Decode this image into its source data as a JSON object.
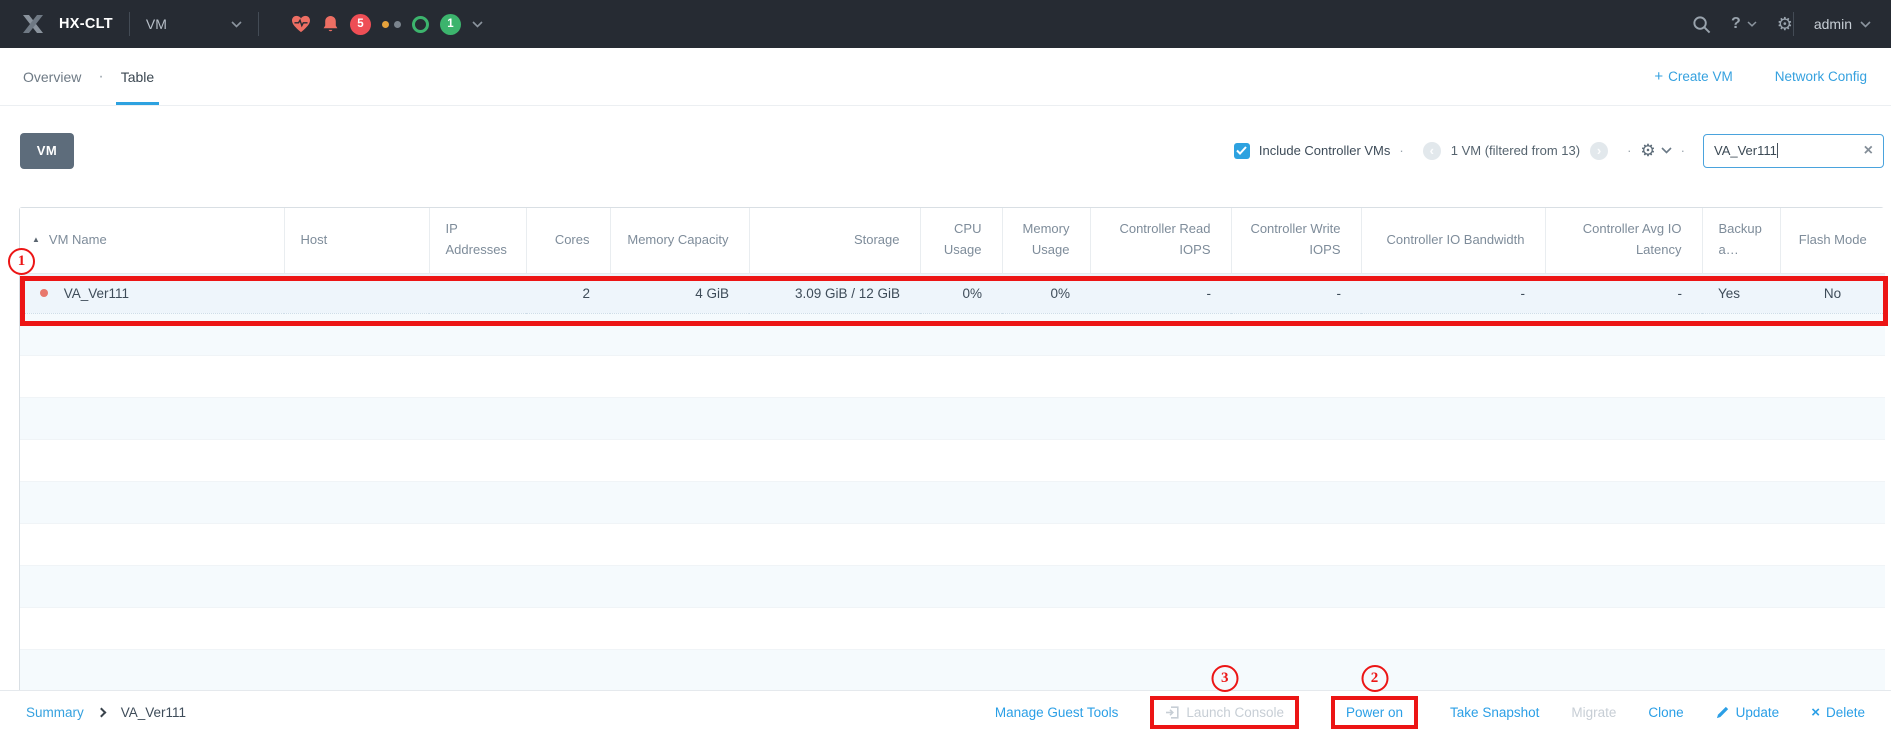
{
  "topnav": {
    "cluster_name": "HX-CLT",
    "entity_menu_label": "VM",
    "alert_count": "5",
    "healthy_count": "1",
    "help_label": "?",
    "username": "admin"
  },
  "subnav": {
    "tabs": [
      {
        "label": "Overview",
        "active": false
      },
      {
        "label": "Table",
        "active": true
      }
    ],
    "actions": [
      {
        "label": "Create VM"
      },
      {
        "label": "Network Config"
      }
    ]
  },
  "toolbar": {
    "entity_button_label": "VM",
    "include_controller_label": "Include Controller VMs",
    "filter_summary": "1 VM (filtered from 13)",
    "search_value": "VA_Ver111"
  },
  "table": {
    "columns": [
      {
        "label": "VM Name",
        "sorted": "asc"
      },
      {
        "label": "Host"
      },
      {
        "label": "IP Addresses"
      },
      {
        "label": "Cores"
      },
      {
        "label": "Memory Capacity"
      },
      {
        "label": "Storage"
      },
      {
        "label": "CPU Usage"
      },
      {
        "label": "Memory Usage"
      },
      {
        "label": "Controller Read IOPS"
      },
      {
        "label": "Controller Write IOPS"
      },
      {
        "label": "Controller IO Bandwidth"
      },
      {
        "label": "Controller Avg IO Latency"
      },
      {
        "label": "Backup a…"
      },
      {
        "label": "Flash Mode"
      }
    ],
    "row": {
      "power_state": "off",
      "cells": [
        "VA_Ver111",
        "",
        "",
        "2",
        "4 GiB",
        "3.09 GiB / 12 GiB",
        "0%",
        "0%",
        "-",
        "-",
        "-",
        "-",
        "Yes",
        "No"
      ]
    }
  },
  "footer": {
    "breadcrumb": {
      "root": "Summary",
      "current": "VA_Ver111"
    },
    "actions": [
      {
        "label": "Manage Guest Tools",
        "enabled": true
      },
      {
        "label": "Launch Console",
        "enabled": false
      },
      {
        "label": "Power on",
        "enabled": true
      },
      {
        "label": "Take Snapshot",
        "enabled": true
      },
      {
        "label": "Migrate",
        "enabled": false
      },
      {
        "label": "Clone",
        "enabled": true
      },
      {
        "label": "Update",
        "enabled": true
      },
      {
        "label": "Delete",
        "enabled": true
      }
    ]
  },
  "annotations": {
    "row_callout": "1",
    "power_on_callout": "2",
    "launch_console_callout": "3",
    "color": "#ec1515"
  }
}
